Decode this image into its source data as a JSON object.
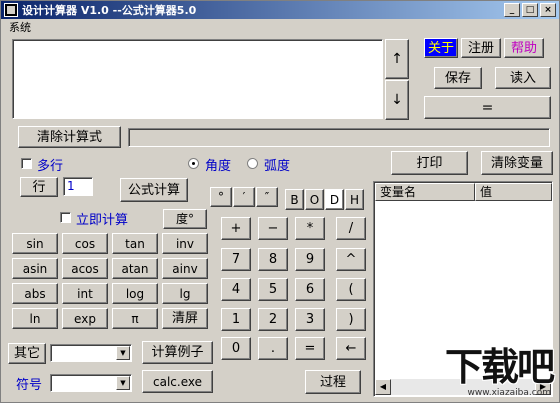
{
  "window": {
    "title": "设计计算器 V1.0 --公式计算器5.0",
    "btn_min": "_",
    "btn_max": "□",
    "btn_close": "×"
  },
  "menu": {
    "system": "系统"
  },
  "top_right": {
    "about": "关于",
    "register": "注册",
    "help": "帮助",
    "save": "保存",
    "load": "读入",
    "equals": "="
  },
  "scroll": {
    "up": "↑",
    "down": "↓"
  },
  "clear_formula": "清除计算式",
  "options": {
    "multiline": "多行",
    "degree": "角度",
    "radian": "弧度",
    "print": "打印",
    "clear_vars": "清除变量"
  },
  "row_label": "行",
  "row_value": "1",
  "formula_calc": "公式计算",
  "immediate_calc": "立即计算",
  "degree_btn": "度°",
  "angle_buttons": [
    "°",
    "′",
    "″"
  ],
  "base_buttons": [
    "B",
    "O",
    "D",
    "H"
  ],
  "func_buttons": [
    [
      "sin",
      "cos",
      "tan",
      "inv"
    ],
    [
      "asin",
      "acos",
      "atan",
      "ainv"
    ],
    [
      "abs",
      "int",
      "log",
      "lg"
    ],
    [
      "ln",
      "exp",
      "π",
      "清屏"
    ]
  ],
  "keypad": [
    [
      "+",
      "−",
      "*",
      "/"
    ],
    [
      "7",
      "8",
      "9",
      "^"
    ],
    [
      "4",
      "5",
      "6",
      "("
    ],
    [
      "1",
      "2",
      "3",
      ")"
    ],
    [
      "0",
      ".",
      "=",
      "←"
    ]
  ],
  "other_label": "其它",
  "symbol_label": "符号",
  "calc_example": "计算例子",
  "calc_exe": "calc.exe",
  "process": "过程",
  "var_table": {
    "col_name": "变量名",
    "col_value": "值"
  },
  "watermark": {
    "main": "下载吧",
    "sub": "www.xiazaiba.com"
  },
  "colors": {
    "title_start": "#0a246a",
    "title_end": "#a6caf0",
    "face": "#d4d0c8",
    "label_blue": "#0000c8"
  }
}
